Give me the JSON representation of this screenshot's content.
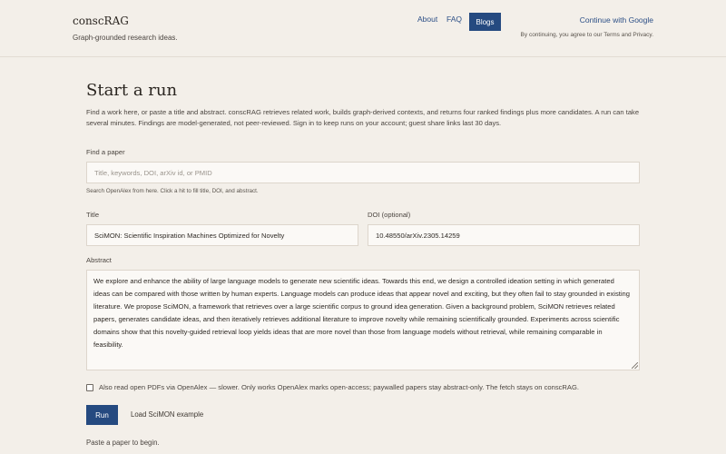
{
  "header": {
    "brand": "conscRAG",
    "tagline": "Graph-grounded research ideas.",
    "nav": {
      "about": "About",
      "faq": "FAQ",
      "blogs": "Blogs"
    },
    "google_login": "Continue with Google",
    "terms": "By continuing, you agree to our Terms and Privacy."
  },
  "main": {
    "title": "Start a run",
    "intro": "Find a work here, or paste a title and abstract. conscRAG retrieves related work, builds graph-derived contexts, and returns four ranked findings plus more candidates. A run can take several minutes. Findings are model-generated, not peer-reviewed. Sign in to keep runs on your account; guest share links last 30 days.",
    "find": {
      "label": "Find a paper",
      "placeholder": "Title, keywords, DOI, arXiv id, or PMID",
      "value": "",
      "help": "Search OpenAlex from here. Click a hit to fill title, DOI, and abstract."
    },
    "title_field": {
      "label": "Title",
      "value": "SciMON: Scientific Inspiration Machines Optimized for Novelty"
    },
    "doi_field": {
      "label": "DOI (optional)",
      "value": "10.48550/arXiv.2305.14259"
    },
    "abstract": {
      "label": "Abstract",
      "value": "We explore and enhance the ability of large language models to generate new scientific ideas. Towards this end, we design a controlled ideation setting in which generated ideas can be compared with those written by human experts. Language models can produce ideas that appear novel and exciting, but they often fail to stay grounded in existing literature. We propose SciMON, a framework that retrieves over a large scientific corpus to ground idea generation. Given a background problem, SciMON retrieves related papers, generates candidate ideas, and then iteratively retrieves additional literature to improve novelty while remaining scientifically grounded. Experiments across scientific domains show that this novelty-guided retrieval loop yields ideas that are more novel than those from language models without retrieval, while remaining comparable in feasibility."
    },
    "pdf_option": {
      "checked": false,
      "label": "Also read open PDFs via OpenAlex — slower. Only works OpenAlex marks open-access; paywalled papers stay abstract-only. The fetch stays on conscRAG."
    },
    "run_label": "Run",
    "example_label": "Load SciMON example",
    "status": "Paste a paper to begin."
  },
  "colors": {
    "background": "#f3efe9",
    "accent": "#254a80",
    "link": "#2c4f86"
  }
}
